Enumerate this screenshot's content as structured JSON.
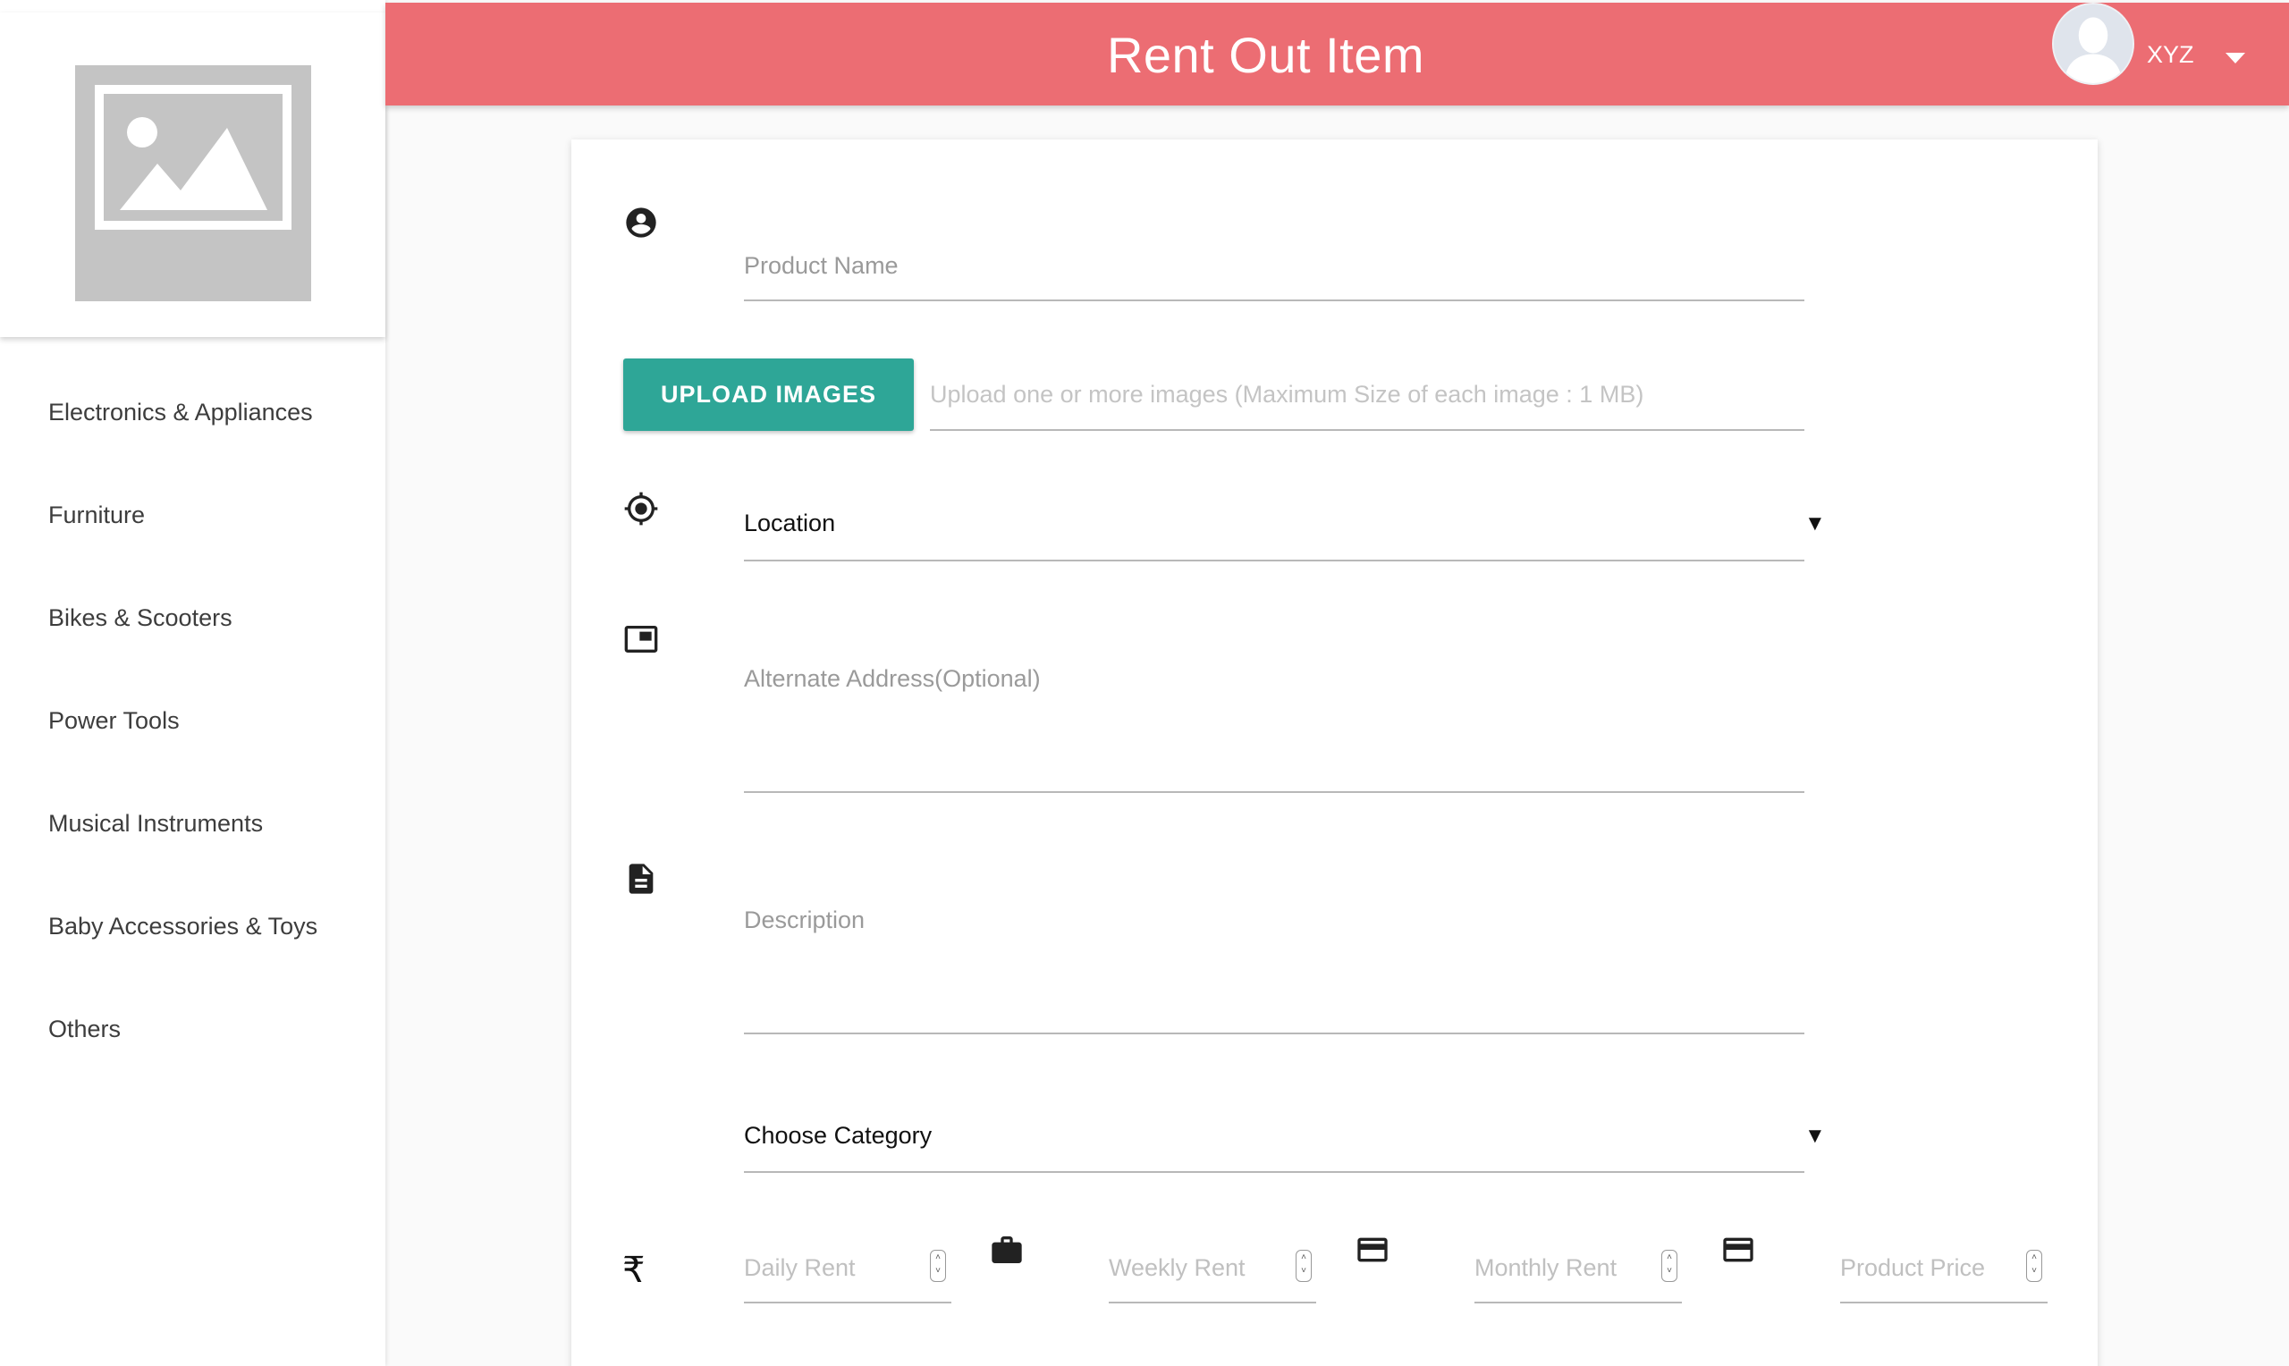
{
  "header": {
    "title": "Rent Out Item",
    "user_name": "XYZ"
  },
  "sidebar": {
    "items": [
      {
        "label": "Electronics & Appliances"
      },
      {
        "label": "Furniture"
      },
      {
        "label": "Bikes & Scooters"
      },
      {
        "label": "Power Tools"
      },
      {
        "label": "Musical Instruments"
      },
      {
        "label": "Baby Accessories & Toys"
      },
      {
        "label": "Others"
      }
    ]
  },
  "form": {
    "product_name": {
      "placeholder": "Product Name",
      "icon": "account-circle-icon"
    },
    "upload": {
      "button_label": "UPLOAD IMAGES",
      "hint": "Upload one or more images (Maximum Size of each image : 1 MB)"
    },
    "location": {
      "label": "Location",
      "icon": "my-location-icon"
    },
    "alternate_address": {
      "placeholder": "Alternate Address(Optional)",
      "icon": "picture-in-picture-icon"
    },
    "description": {
      "placeholder": "Description",
      "icon": "description-icon"
    },
    "category": {
      "label": "Choose Category"
    },
    "pricing": {
      "currency_symbol": "₹",
      "daily_rent": "Daily Rent",
      "weekly_rent": "Weekly Rent",
      "monthly_rent": "Monthly Rent",
      "product_price": "Product Price"
    }
  },
  "colors": {
    "header": "#ec6d73",
    "button": "#2ea697"
  }
}
